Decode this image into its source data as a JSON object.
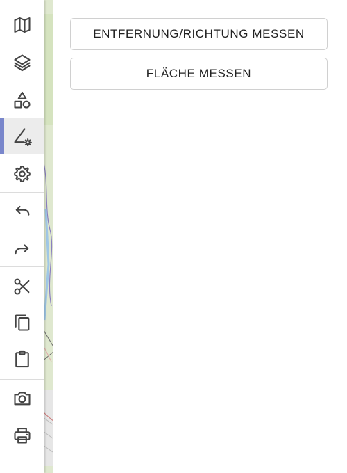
{
  "toolbar": {
    "items": [
      {
        "icon": "map-icon"
      },
      {
        "icon": "layers-icon"
      },
      {
        "icon": "shapes-icon"
      },
      {
        "icon": "measure-tool-icon",
        "active": true
      },
      {
        "icon": "settings-icon"
      },
      {
        "icon": "undo-icon"
      },
      {
        "icon": "redo-icon"
      },
      {
        "icon": "cut-icon"
      },
      {
        "icon": "copy-icon"
      },
      {
        "icon": "paste-icon"
      },
      {
        "icon": "camera-icon"
      },
      {
        "icon": "print-icon"
      }
    ],
    "active_indicator_color": "#7986cb"
  },
  "panel": {
    "buttons": [
      {
        "label": "ENTFERNUNG/RICHTUNG MESSEN"
      },
      {
        "label": "FLÄCHE MESSEN"
      }
    ]
  },
  "colors": {
    "map_background": "#dfe8cf",
    "icon": "#444444",
    "button_border": "#d0d0d0"
  }
}
